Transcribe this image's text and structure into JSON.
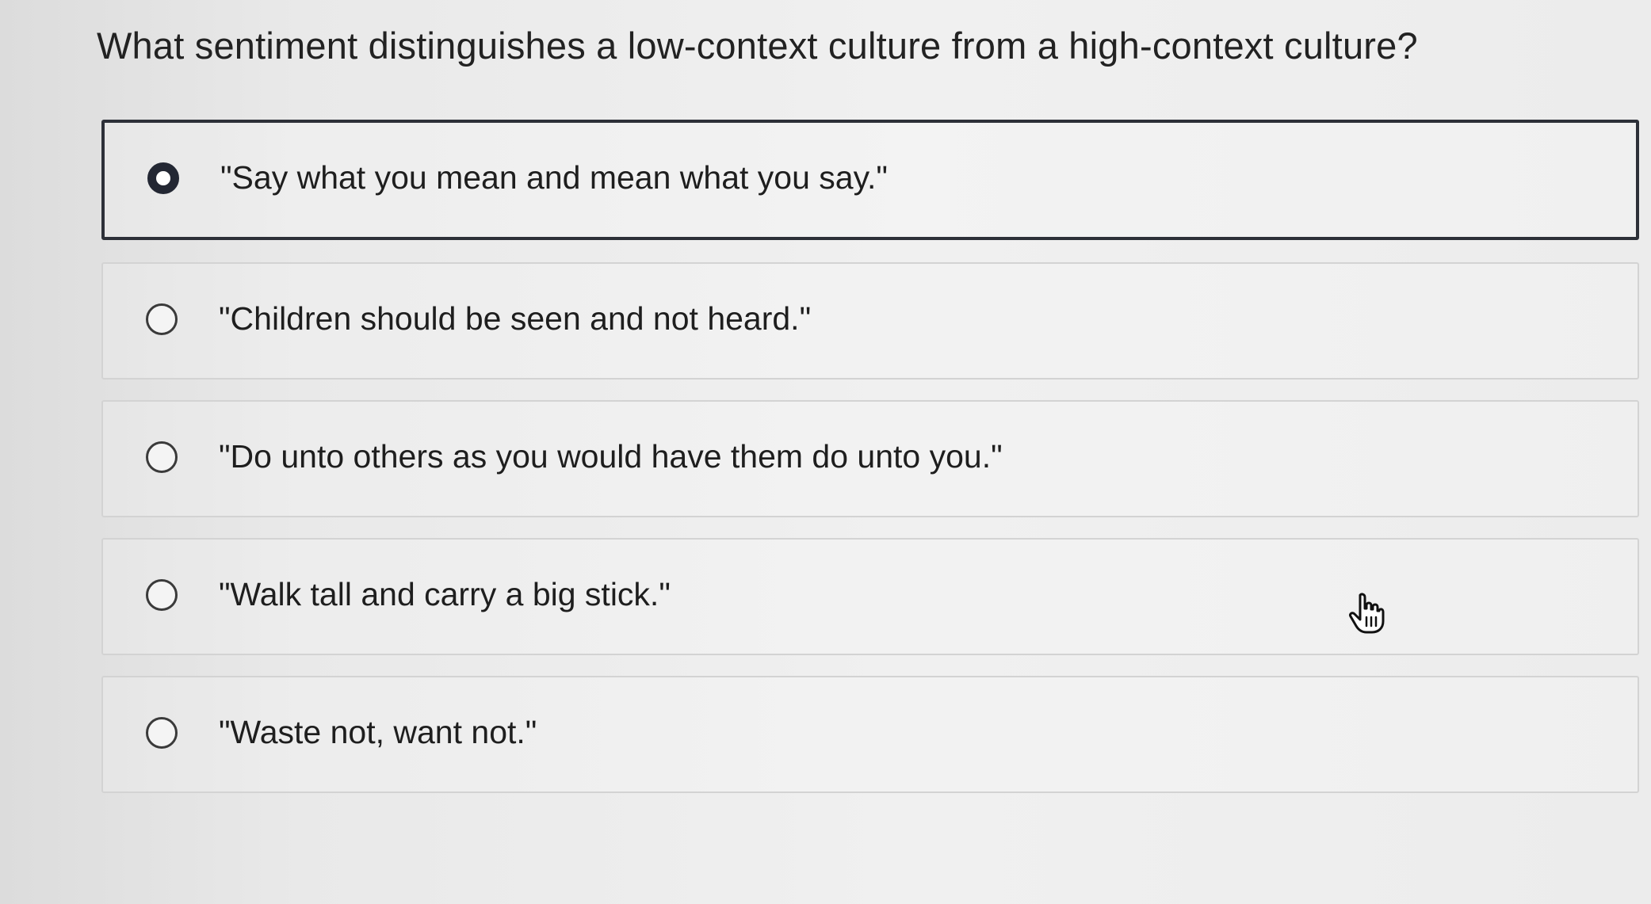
{
  "question": {
    "text": "What sentiment distinguishes a low-context culture from a high-context culture?"
  },
  "options": [
    {
      "label": "\"Say what you mean and mean what you say.\"",
      "selected": true
    },
    {
      "label": "\"Children should be seen and not heard.\"",
      "selected": false
    },
    {
      "label": "\"Do unto others as you would have them do unto you.\"",
      "selected": false
    },
    {
      "label": "\"Walk tall and carry a big stick.\"",
      "selected": false
    },
    {
      "label": "\"Waste not, want not.\"",
      "selected": false
    }
  ],
  "cursor": {
    "icon": "hand-pointer-icon"
  },
  "colors": {
    "selected_border": "#2d3038",
    "option_border": "#d3d3d3",
    "radio_selected": "#232733"
  }
}
